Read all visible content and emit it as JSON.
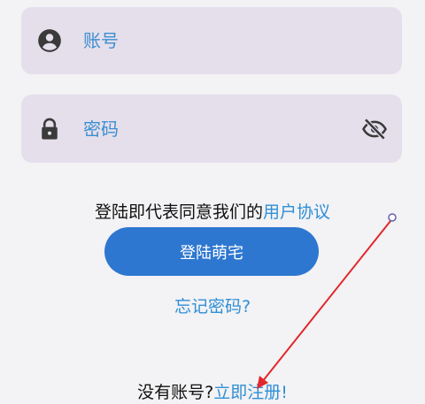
{
  "account_field": {
    "placeholder": "账号",
    "icon": "account-circle-icon"
  },
  "password_field": {
    "placeholder": "密码",
    "icon": "lock-icon",
    "toggle_icon": "eye-off-icon"
  },
  "agreement": {
    "prefix": "登陆即代表同意我们的",
    "link": "用户协议"
  },
  "login_button": {
    "label": "登陆萌宅"
  },
  "forgot_password": {
    "label": "忘记密码?"
  },
  "register": {
    "prefix": "没有账号?",
    "link": "立即注册!"
  },
  "colors": {
    "accent": "#2e77d0",
    "link": "#2f8fd6",
    "field_bg": "#e5dfec",
    "annotation_arrow": "#e0282d"
  }
}
